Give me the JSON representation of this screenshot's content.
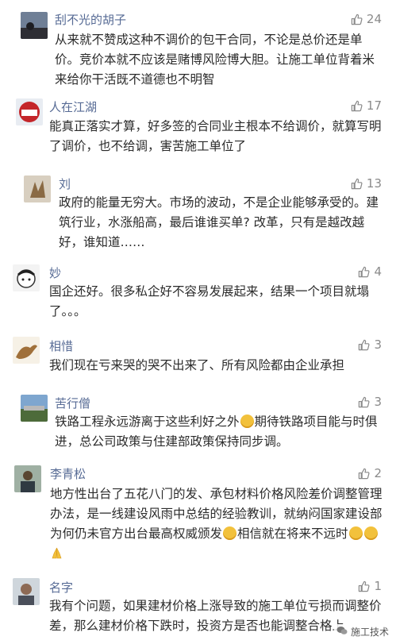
{
  "comments": [
    {
      "name": "刮不光的胡子",
      "likes": "24",
      "text": "从来就不赞成这种不调价的包干合同，不论是总价还是单价。竞价本就不应该是赌博风险博大胆。让施工单位背着米来给你干活既不道德也不明智"
    },
    {
      "name": "人在江湖",
      "likes": "17",
      "text": "能真正落实才算，好多签的合同业主根本不给调价，就算写明了调价，也不给调，害苦施工单位了"
    },
    {
      "name": "刘",
      "likes": "13",
      "text": "政府的能量无穷大。市场的波动，不是企业能够承受的。建筑行业，水涨船高，最后谁谁买单? 改革，只有是越改越好，谁知道……"
    },
    {
      "name": "妙",
      "likes": "4",
      "text": "国企还好。很多私企好不容易发展起来，结果一个项目就塌了。。。"
    },
    {
      "name": "相惜",
      "likes": "3",
      "text": "我们现在亏来哭的哭不出来了、所有风险都由企业承担"
    },
    {
      "name": "苦行僧",
      "likes": "3",
      "text_a": "铁路工程永远游离于这些利好之外",
      "text_b": "期待铁路项目能与时俱进，总公司政策与住建部政策保持同步调。"
    },
    {
      "name": "李青松",
      "likes": "2",
      "text_a": "地方性出台了五花八门的发、承包材料价格风险差价调整管理办法，是一线建设风雨中总结的经验教训，就纳闷国家建设部为何仍未官方出台最高权威颁发",
      "text_b": "相信就在将来不远时"
    },
    {
      "name": "名字",
      "likes": "1",
      "text": "我有个问题，如果建材价格上涨导致的施工单位亏损而调整价差，那么建材价格下跌时，投资方是否也能调整合格上"
    }
  ],
  "watermark": "施工技术",
  "icons": {
    "like": "thumbs-up-icon",
    "watermark": "wechat-logo-icon"
  },
  "colors": {
    "name": "#576b95",
    "likes": "#8a8a8a",
    "text": "#2b2b2b"
  }
}
